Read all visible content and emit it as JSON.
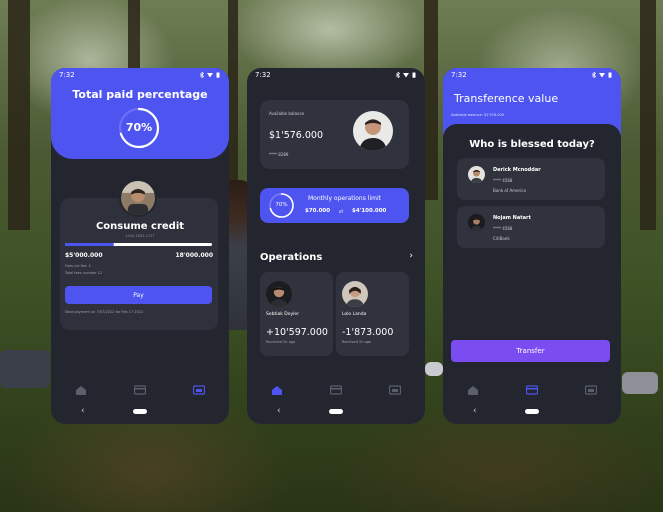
{
  "colors": {
    "accent": "#4e54f0",
    "transfer_button": "#7b4df0",
    "screen_bg": "#23262f",
    "card_bg": "#30333e",
    "nav_icon": "#5b5f6d",
    "nav_active": "#4e54f0"
  },
  "status_bar": {
    "time": "7:32",
    "icons": [
      "bluetooth-icon",
      "wifi-icon",
      "battery-icon"
    ]
  },
  "navigation": {
    "items": [
      "home-icon",
      "card-icon",
      "wallet-icon"
    ]
  },
  "gesture_bar": {
    "back_glyph": "‹"
  },
  "screen_credit": {
    "title": "Total paid percentage",
    "percentage_text": "70%",
    "percentage": 70,
    "card_title": "Consume credit",
    "card_subtitle": "1040-1843-1727",
    "progress_fraction": 0.33,
    "amount_left": "$5'000.000",
    "amount_right": "18'000.000",
    "line_1": "Fees cut fee: 4",
    "line_2": "Total fees number 12",
    "pay_button": "Pay",
    "next_payment": "Next payment on 7/07/2022 for Feb 17 2022",
    "active_nav": 2
  },
  "screen_home": {
    "balance_label": "Available balance",
    "balance_value": "$1'576.000",
    "card_masked": "**** 8289",
    "limit_percent_text": "70%",
    "limit_percent": 70,
    "limit_title": "Monthly operations limit",
    "limit_used": "$70.000",
    "limit_of": "of",
    "limit_total": "$4'100.000",
    "operations_title": "Operations",
    "operations_chevron": "›",
    "operations": [
      {
        "name": "Sebtiak Doyler",
        "amount": "+10'597.000",
        "when": "Received 2h ago"
      },
      {
        "name": "Lolo Landa",
        "amount": "-1'873.000",
        "when": "Received 2h ago"
      }
    ],
    "active_nav": 0
  },
  "screen_transfer": {
    "title": "Transference value",
    "available_balance": "Available balance: $1'576.000",
    "question": "Who is blessed today?",
    "recipients": [
      {
        "name": "Derick Mcnoddar",
        "card": "**** 4568",
        "bank": "Bank of America"
      },
      {
        "name": "Nojam Natart",
        "card": "**** 4568",
        "bank": "CitiBank"
      }
    ],
    "transfer_button": "Transfer",
    "active_nav": 1
  }
}
